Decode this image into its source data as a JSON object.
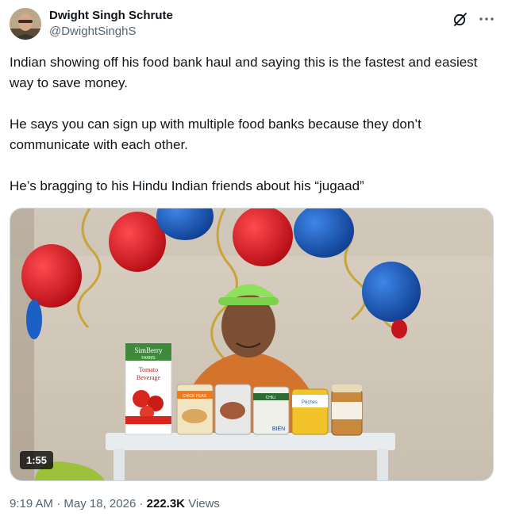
{
  "author": {
    "display_name": "Dwight Singh Schrute",
    "handle": "@DwightSinghS",
    "avatar_icon": "avatar-photo"
  },
  "actions": {
    "grok_icon": "grok-icon",
    "more_icon": "more-icon"
  },
  "tweet": {
    "paragraphs": [
      "Indian showing off his food bank haul and saying this is the fastest and easiest way to save money.",
      "He says you can sign up with multiple food banks because they don’t communicate with each other.",
      "He’s bragging to his Hindu Indian friends about his “jugaad”"
    ]
  },
  "media": {
    "duration": "1:55",
    "carton_brand": "SimBerry",
    "carton_sub": "FARMS",
    "carton_label_1": "Tomato",
    "carton_label_2": "Beverage",
    "can_label_1": "CHICK PEAS",
    "can_label_3": "CHILI",
    "can_label_4": "Pêches",
    "can_brand_3": "BIEN"
  },
  "meta": {
    "time": "9:19 AM",
    "separator": "·",
    "date": "May 18, 2026",
    "views_count": "222.3K",
    "views_label": "Views"
  },
  "colors": {
    "text_primary": "#0f1419",
    "text_secondary": "#536471",
    "border": "#cfd9de",
    "balloon_red": "#d2121c",
    "balloon_blue": "#1a5fc1"
  }
}
